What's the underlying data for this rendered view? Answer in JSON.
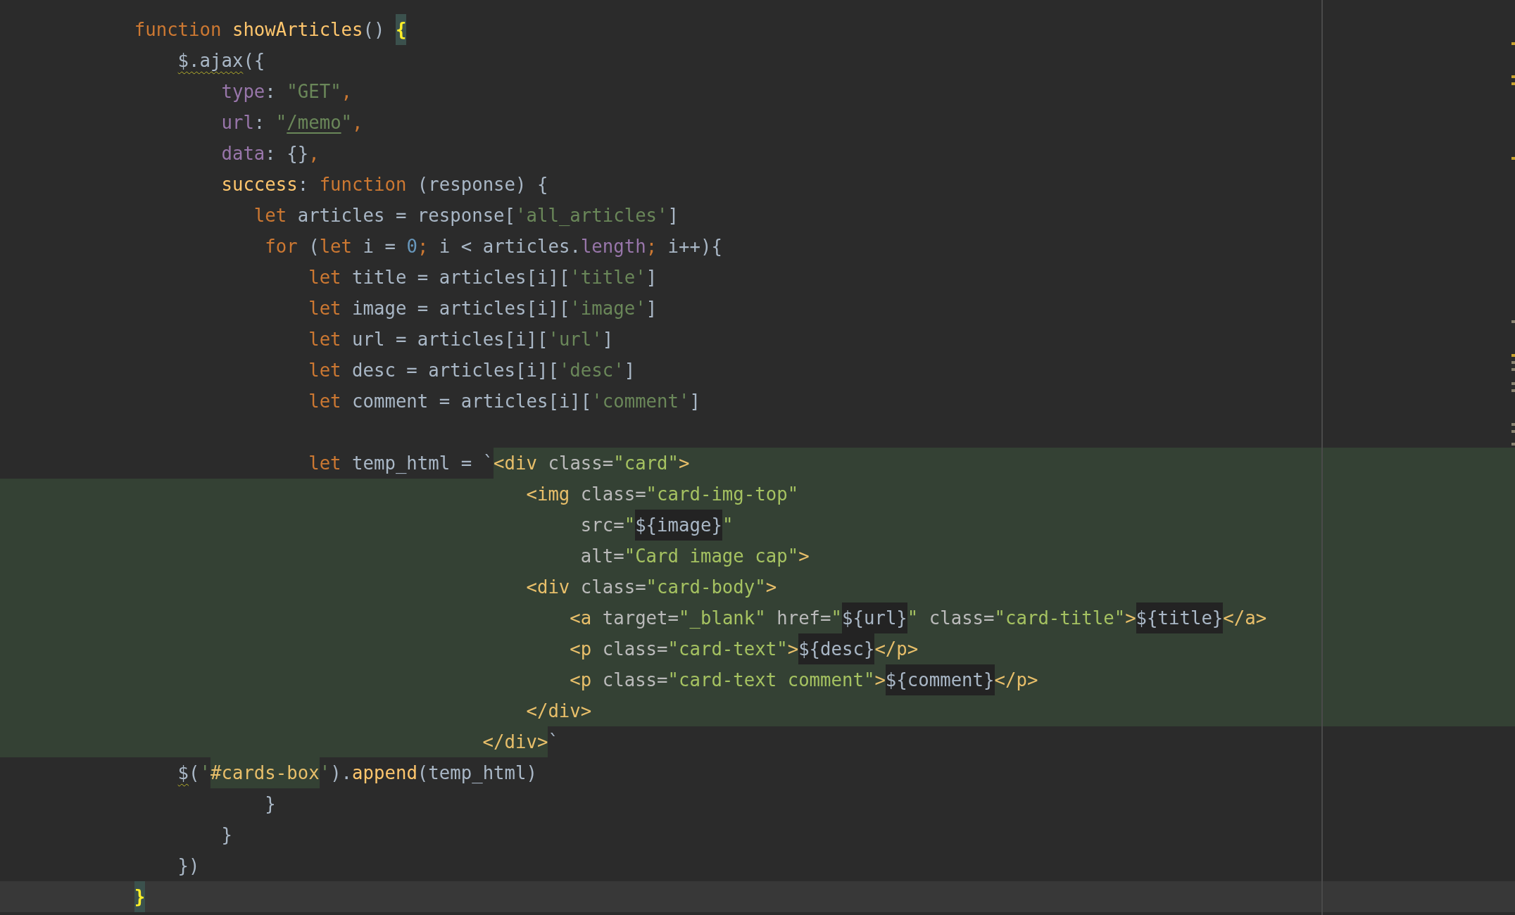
{
  "editor": {
    "lines": [
      {
        "tokens": [
          {
            "kind": "keyword",
            "text": "        function "
          },
          {
            "kind": "function",
            "text": "showArticles"
          },
          {
            "kind": "plain",
            "text": "() "
          },
          {
            "kind": "brace_match",
            "text": "{"
          }
        ]
      },
      {
        "tokens": [
          {
            "kind": "warning",
            "text": "            $.ajax"
          },
          {
            "kind": "plain",
            "text": "({"
          }
        ]
      },
      {
        "tokens": [
          {
            "kind": "property",
            "text": "                type"
          },
          {
            "kind": "plain",
            "text": ": "
          },
          {
            "kind": "string",
            "text": "\"GET\""
          },
          {
            "kind": "keyword",
            "text": ","
          }
        ]
      },
      {
        "tokens": [
          {
            "kind": "property",
            "text": "                url"
          },
          {
            "kind": "plain",
            "text": ": "
          },
          {
            "kind": "string",
            "text": "\""
          },
          {
            "kind": "link",
            "text": "/memo"
          },
          {
            "kind": "string",
            "text": "\""
          },
          {
            "kind": "keyword",
            "text": ","
          }
        ]
      },
      {
        "tokens": [
          {
            "kind": "property",
            "text": "                data"
          },
          {
            "kind": "plain",
            "text": ": {}"
          },
          {
            "kind": "keyword",
            "text": ","
          }
        ]
      },
      {
        "tokens": [
          {
            "kind": "function",
            "text": "                success"
          },
          {
            "kind": "plain",
            "text": ": "
          },
          {
            "kind": "keyword",
            "text": "function "
          },
          {
            "kind": "plain",
            "text": "(response) {"
          }
        ]
      },
      {
        "tokens": [
          {
            "kind": "keyword",
            "text": "                   let "
          },
          {
            "kind": "plain",
            "text": "articles = response["
          },
          {
            "kind": "string",
            "text": "'all_articles'"
          },
          {
            "kind": "plain",
            "text": "]"
          }
        ]
      },
      {
        "tokens": [
          {
            "kind": "keyword",
            "text": "                    for "
          },
          {
            "kind": "plain",
            "text": "("
          },
          {
            "kind": "keyword",
            "text": "let "
          },
          {
            "kind": "plain",
            "text": "i = "
          },
          {
            "kind": "number",
            "text": "0"
          },
          {
            "kind": "keyword",
            "text": "; "
          },
          {
            "kind": "plain",
            "text": "i < articles."
          },
          {
            "kind": "property",
            "text": "length"
          },
          {
            "kind": "keyword",
            "text": "; "
          },
          {
            "kind": "plain",
            "text": "i++){"
          }
        ]
      },
      {
        "tokens": [
          {
            "kind": "keyword",
            "text": "                        let "
          },
          {
            "kind": "plain",
            "text": "title = articles[i]["
          },
          {
            "kind": "string",
            "text": "'title'"
          },
          {
            "kind": "plain",
            "text": "]"
          }
        ]
      },
      {
        "tokens": [
          {
            "kind": "keyword",
            "text": "                        let "
          },
          {
            "kind": "plain",
            "text": "image = articles[i]["
          },
          {
            "kind": "string",
            "text": "'image'"
          },
          {
            "kind": "plain",
            "text": "]"
          }
        ]
      },
      {
        "tokens": [
          {
            "kind": "keyword",
            "text": "                        let "
          },
          {
            "kind": "plain",
            "text": "url = articles[i]["
          },
          {
            "kind": "string",
            "text": "'url'"
          },
          {
            "kind": "plain",
            "text": "]"
          }
        ]
      },
      {
        "tokens": [
          {
            "kind": "keyword",
            "text": "                        let "
          },
          {
            "kind": "plain",
            "text": "desc = articles[i]["
          },
          {
            "kind": "string",
            "text": "'desc'"
          },
          {
            "kind": "plain",
            "text": "]"
          }
        ]
      },
      {
        "tokens": [
          {
            "kind": "keyword",
            "text": "                        let "
          },
          {
            "kind": "plain",
            "text": "comment = articles[i]["
          },
          {
            "kind": "string",
            "text": "'comment'"
          },
          {
            "kind": "plain",
            "text": "]"
          }
        ]
      },
      {
        "gap_before": true,
        "fill_to_edge": true,
        "tokens": [
          {
            "kind": "keyword",
            "text": "                        let "
          },
          {
            "kind": "plain",
            "text": "temp_html = `"
          },
          {
            "kind": "tag",
            "text": "<div",
            "injected": true
          },
          {
            "kind": "attribute",
            "text": " class=",
            "injected": true
          },
          {
            "kind": "attr_value",
            "text": "\"card\"",
            "injected": true
          },
          {
            "kind": "tag",
            "text": ">",
            "injected": true
          }
        ]
      },
      {
        "fill_to_edge": true,
        "tokens": [
          {
            "kind": "tag",
            "text": "                                            <img",
            "injected": true
          },
          {
            "kind": "attribute",
            "text": " class=",
            "injected": true
          },
          {
            "kind": "attr_value",
            "text": "\"card-img-top\"",
            "injected": true
          }
        ]
      },
      {
        "fill_to_edge": true,
        "tokens": [
          {
            "kind": "attribute",
            "text": "                                                 src=",
            "injected": true
          },
          {
            "kind": "attr_value",
            "text": "\"",
            "injected": true
          },
          {
            "kind": "interpolation",
            "text": "${image}"
          },
          {
            "kind": "attr_value",
            "text": "\"",
            "injected": true
          }
        ]
      },
      {
        "fill_to_edge": true,
        "tokens": [
          {
            "kind": "attribute",
            "text": "                                                 alt=",
            "injected": true
          },
          {
            "kind": "attr_value",
            "text": "\"Card image cap\"",
            "injected": true
          },
          {
            "kind": "tag",
            "text": ">",
            "injected": true
          }
        ]
      },
      {
        "fill_to_edge": true,
        "tokens": [
          {
            "kind": "tag",
            "text": "                                            <div",
            "injected": true
          },
          {
            "kind": "attribute",
            "text": " class=",
            "injected": true
          },
          {
            "kind": "attr_value",
            "text": "\"card-body\"",
            "injected": true
          },
          {
            "kind": "tag",
            "text": ">",
            "injected": true
          }
        ]
      },
      {
        "fill_to_edge": true,
        "tokens": [
          {
            "kind": "tag",
            "text": "                                                <a",
            "injected": true
          },
          {
            "kind": "attribute",
            "text": " target=",
            "injected": true
          },
          {
            "kind": "attr_value",
            "text": "\"_blank\"",
            "injected": true
          },
          {
            "kind": "attribute",
            "text": " href=",
            "injected": true
          },
          {
            "kind": "attr_value",
            "text": "\"",
            "injected": true
          },
          {
            "kind": "interpolation",
            "text": "${url}"
          },
          {
            "kind": "attr_value",
            "text": "\"",
            "injected": true
          },
          {
            "kind": "attribute",
            "text": " class=",
            "injected": true
          },
          {
            "kind": "attr_value",
            "text": "\"card-title\"",
            "injected": true
          },
          {
            "kind": "tag",
            "text": ">",
            "injected": true
          },
          {
            "kind": "interpolation",
            "text": "${title}"
          },
          {
            "kind": "tag",
            "text": "</a>",
            "injected": true
          }
        ]
      },
      {
        "fill_to_edge": true,
        "tokens": [
          {
            "kind": "tag",
            "text": "                                                <p",
            "injected": true
          },
          {
            "kind": "attribute",
            "text": " class=",
            "injected": true
          },
          {
            "kind": "attr_value",
            "text": "\"card-text\"",
            "injected": true
          },
          {
            "kind": "tag",
            "text": ">",
            "injected": true
          },
          {
            "kind": "interpolation",
            "text": "${desc}"
          },
          {
            "kind": "tag",
            "text": "</p>",
            "injected": true
          }
        ]
      },
      {
        "fill_to_edge": true,
        "tokens": [
          {
            "kind": "tag",
            "text": "                                                <p",
            "injected": true
          },
          {
            "kind": "attribute",
            "text": " class=",
            "injected": true
          },
          {
            "kind": "attr_value",
            "text": "\"card-text comment\"",
            "injected": true
          },
          {
            "kind": "tag",
            "text": ">",
            "injected": true
          },
          {
            "kind": "interpolation",
            "text": "${comment}"
          },
          {
            "kind": "tag",
            "text": "</p>",
            "injected": true
          }
        ]
      },
      {
        "fill_to_edge": true,
        "tokens": [
          {
            "kind": "tag",
            "text": "                                            </div>",
            "injected": true
          }
        ]
      },
      {
        "fill_to_edge": false,
        "tokens": [
          {
            "kind": "tag",
            "text": "                                        </div>",
            "injected": true
          },
          {
            "kind": "plain",
            "text": "`"
          }
        ]
      },
      {
        "tokens": [
          {
            "kind": "warning",
            "text": "            $"
          },
          {
            "kind": "plain",
            "text": "("
          },
          {
            "kind": "string",
            "text": "'"
          },
          {
            "kind": "selector",
            "text": "#cards-box",
            "injected": true
          },
          {
            "kind": "string",
            "text": "'"
          },
          {
            "kind": "plain",
            "text": ")."
          },
          {
            "kind": "function",
            "text": "append"
          },
          {
            "kind": "plain",
            "text": "(temp_html)"
          }
        ]
      },
      {
        "tokens": [
          {
            "kind": "plain",
            "text": "                    }"
          }
        ]
      },
      {
        "tokens": [
          {
            "kind": "plain",
            "text": "                }"
          }
        ]
      },
      {
        "tokens": [
          {
            "kind": "plain",
            "text": "            })"
          }
        ]
      },
      {
        "current": true,
        "tokens": [
          {
            "kind": "brace_match",
            "text": "        }"
          }
        ]
      }
    ]
  }
}
